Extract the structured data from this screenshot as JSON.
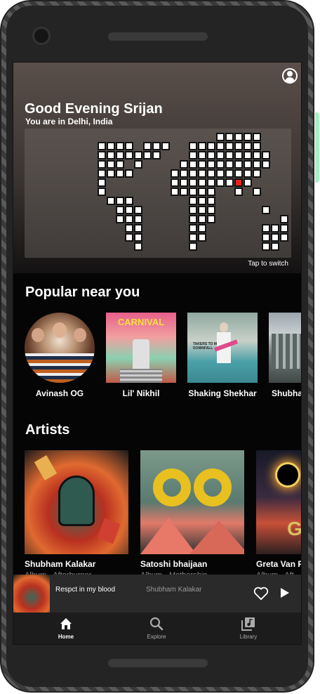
{
  "header": {
    "greeting": "Good Evening Srijan",
    "location": "You are in Delhi, India",
    "map_hint": "Tap to switch",
    "profile_icon": "account-circle-icon"
  },
  "popular": {
    "title": "Popular near you",
    "items": [
      {
        "label": "Avinash OG"
      },
      {
        "label": "Lil' Nikhil",
        "art_text": "CARNIVAL"
      },
      {
        "label": "Shaking Shekhar",
        "art_text": "TAKERS TO MY DOWNFALL"
      },
      {
        "label": "Shubha"
      }
    ]
  },
  "artists": {
    "title": "Artists",
    "items": [
      {
        "name": "Shubham Kalakar",
        "sub": "Album · Afterburner"
      },
      {
        "name": "Satoshi bhaijaan",
        "sub": "Album · Mothership"
      },
      {
        "name": "Greta Van F",
        "sub": "Album · Aft"
      }
    ]
  },
  "player": {
    "title": "Respct in my blood",
    "artist": "Shubham Kalakar"
  },
  "nav": {
    "home": "Home",
    "explore": "Explore",
    "library": "Library"
  },
  "colors": {
    "background": "#050505",
    "marker": "#e8211b",
    "player_bar": "#2a2a2a"
  }
}
